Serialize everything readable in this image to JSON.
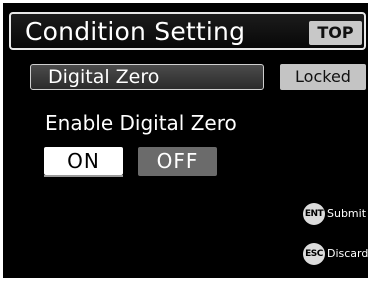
{
  "header": {
    "title": "Condition Setting",
    "top_button": "TOP"
  },
  "field": {
    "label": "Digital Zero",
    "status_button": "Locked"
  },
  "option": {
    "label": "Enable Digital Zero",
    "on_label": "ON",
    "off_label": "OFF",
    "selected": "ON"
  },
  "key_hints": [
    {
      "key": "ENT",
      "label": "Submit"
    },
    {
      "key": "ESC",
      "label": "Discard"
    }
  ],
  "colors": {
    "background": "#000000",
    "selected_button": "#ffffff",
    "unselected_button": "#6b6b6b",
    "gray_button": "#c8c8c8"
  }
}
